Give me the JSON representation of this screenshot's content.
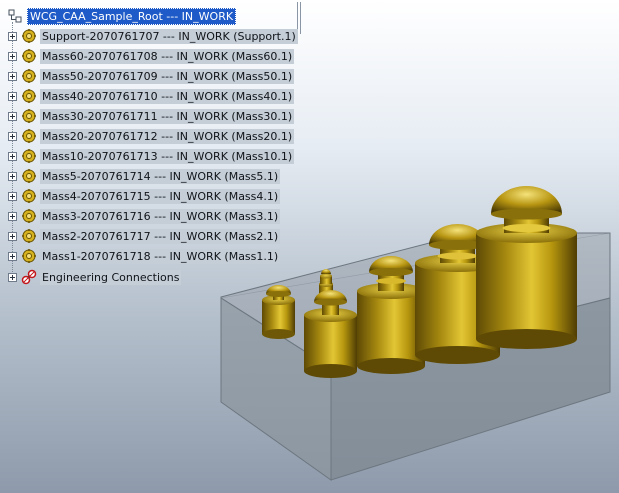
{
  "tree": {
    "root": {
      "label": "WCG_CAA_Sample_Root --- IN_WORK",
      "icon": "product-root-icon"
    },
    "items": [
      {
        "label": "Support-2070761707 --- IN_WORK (Support.1)",
        "icon": "part-gear-icon"
      },
      {
        "label": "Mass60-2070761708 --- IN_WORK (Mass60.1)",
        "icon": "part-gear-icon"
      },
      {
        "label": "Mass50-2070761709 --- IN_WORK (Mass50.1)",
        "icon": "part-gear-icon"
      },
      {
        "label": "Mass40-2070761710 --- IN_WORK (Mass40.1)",
        "icon": "part-gear-icon"
      },
      {
        "label": "Mass30-2070761711 --- IN_WORK (Mass30.1)",
        "icon": "part-gear-icon"
      },
      {
        "label": "Mass20-2070761712 --- IN_WORK (Mass20.1)",
        "icon": "part-gear-icon"
      },
      {
        "label": "Mass10-2070761713 --- IN_WORK (Mass10.1)",
        "icon": "part-gear-icon"
      },
      {
        "label": "Mass5-2070761714 --- IN_WORK (Mass5.1)",
        "icon": "part-gear-icon"
      },
      {
        "label": "Mass4-2070761715 --- IN_WORK (Mass4.1)",
        "icon": "part-gear-icon"
      },
      {
        "label": "Mass3-2070761716 --- IN_WORK (Mass3.1)",
        "icon": "part-gear-icon"
      },
      {
        "label": "Mass2-2070761717 --- IN_WORK (Mass2.1)",
        "icon": "part-gear-icon"
      },
      {
        "label": "Mass1-2070761718 --- IN_WORK (Mass1.1)",
        "icon": "part-gear-icon"
      }
    ],
    "connections": {
      "label": "Engineering Connections",
      "icon": "engineering-connections-icon"
    }
  },
  "colors": {
    "selection": "#1e5ac8",
    "row_highlight": "#c5cdd7",
    "brass": "#b8960e"
  }
}
